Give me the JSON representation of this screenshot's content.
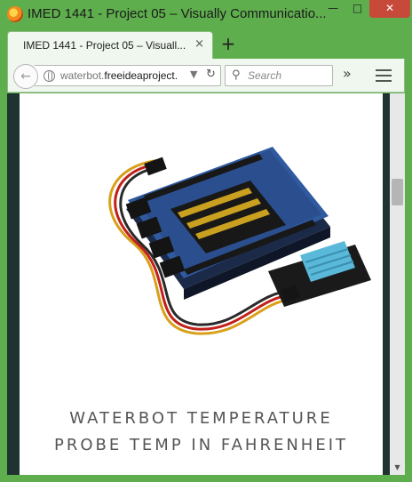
{
  "window": {
    "title": "IMED 1441 - Project 05 – Visually Communicatio..."
  },
  "tabs": [
    {
      "label": "IMED 1441 - Project 05 – Visuall...",
      "close": "×"
    }
  ],
  "newtab": "+",
  "nav": {
    "url_host_prefix": "waterbot.",
    "url_host_bold": "freeideaproject.",
    "search_placeholder": "Search",
    "overflow": "»"
  },
  "content": {
    "caption_line1": "WATERBOT TEMPERATURE",
    "caption_line2": "PROBE TEMP IN FAHRENHEIT"
  },
  "colors": {
    "chrome": "#5fae4e",
    "page_margin": "#1f3330",
    "caption": "#555555"
  },
  "icons": {
    "firefox": "firefox-logo",
    "back": "back-arrow-icon",
    "globe": "globe-icon",
    "reload": "reload-icon",
    "search": "search-icon",
    "menu": "hamburger-menu-icon"
  }
}
